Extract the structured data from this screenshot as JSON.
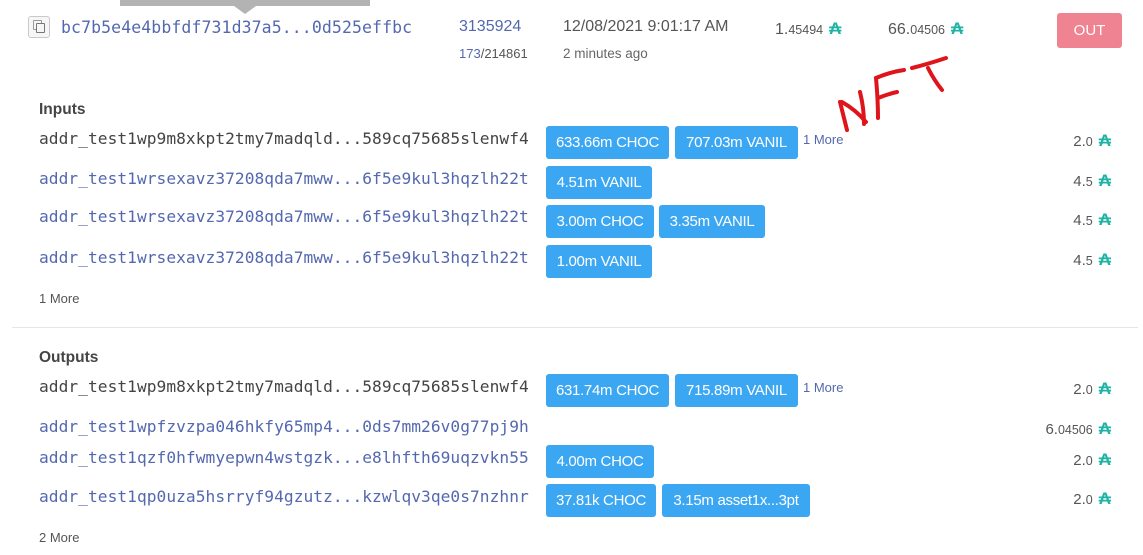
{
  "tx": {
    "hash": "bc7b5e4e4bbfdf731d37a5...0d525effbc",
    "block": "3135924",
    "epoch_slot_current": "173",
    "epoch_slot_total": "/214861",
    "date": "12/08/2021 9:01:17 AM",
    "time_ago": "2 minutes ago",
    "fee_int": "1.",
    "fee_dec": "45494",
    "amount_int": "66.",
    "amount_dec": "04506",
    "ada_symbol": "₳",
    "direction_badge": "OUT",
    "annotation": "NFT"
  },
  "inputs": {
    "title": "Inputs",
    "more_label": "1 More",
    "rows": [
      {
        "address": "addr_test1wp9m8xkpt2tmy7madqld...589cq75685slenwf4",
        "tokens": [
          "633.66m CHOC",
          "707.03m VANIL"
        ],
        "more": "1 More",
        "amount_int": "2.",
        "amount_dec": "0"
      },
      {
        "address": "addr_test1wrsexavz37208qda7mww...6f5e9kul3hqzlh22t",
        "tokens": [
          "4.51m VANIL"
        ],
        "more": "",
        "amount_int": "4.",
        "amount_dec": "5"
      },
      {
        "address": "addr_test1wrsexavz37208qda7mww...6f5e9kul3hqzlh22t",
        "tokens": [
          "3.00m CHOC",
          "3.35m VANIL"
        ],
        "more": "",
        "amount_int": "4.",
        "amount_dec": "5"
      },
      {
        "address": "addr_test1wrsexavz37208qda7mww...6f5e9kul3hqzlh22t",
        "tokens": [
          "1.00m VANIL"
        ],
        "more": "",
        "amount_int": "4.",
        "amount_dec": "5"
      }
    ]
  },
  "outputs": {
    "title": "Outputs",
    "more_label": "2 More",
    "rows": [
      {
        "address": "addr_test1wp9m8xkpt2tmy7madqld...589cq75685slenwf4",
        "tokens": [
          "631.74m CHOC",
          "715.89m VANIL"
        ],
        "more": "1 More",
        "amount_int": "2.",
        "amount_dec": "0"
      },
      {
        "address": "addr_test1wpfzvzpa046hkfy65mp4...0ds7mm26v0g77pj9h",
        "tokens": [],
        "more": "",
        "amount_int": "6.",
        "amount_dec": "04506"
      },
      {
        "address": "addr_test1qzf0hfwmyepwn4wstgzk...e8lhfth69uqzvkn55",
        "tokens": [
          "4.00m CHOC"
        ],
        "more": "",
        "amount_int": "2.",
        "amount_dec": "0"
      },
      {
        "address": "addr_test1qp0uza5hsrryf94gzutz...kzwlqv3qe0s7nzhnr",
        "tokens": [
          "37.81k CHOC",
          "3.15m asset1x...3pt"
        ],
        "more": "",
        "amount_int": "2.",
        "amount_dec": "0"
      }
    ]
  },
  "colors": {
    "link": "#5468b0",
    "token_badge": "#3ba7f2",
    "out_badge": "#ef8391",
    "ada_symbol": "#1eb3a4",
    "annotation_ink": "#e0141b"
  }
}
